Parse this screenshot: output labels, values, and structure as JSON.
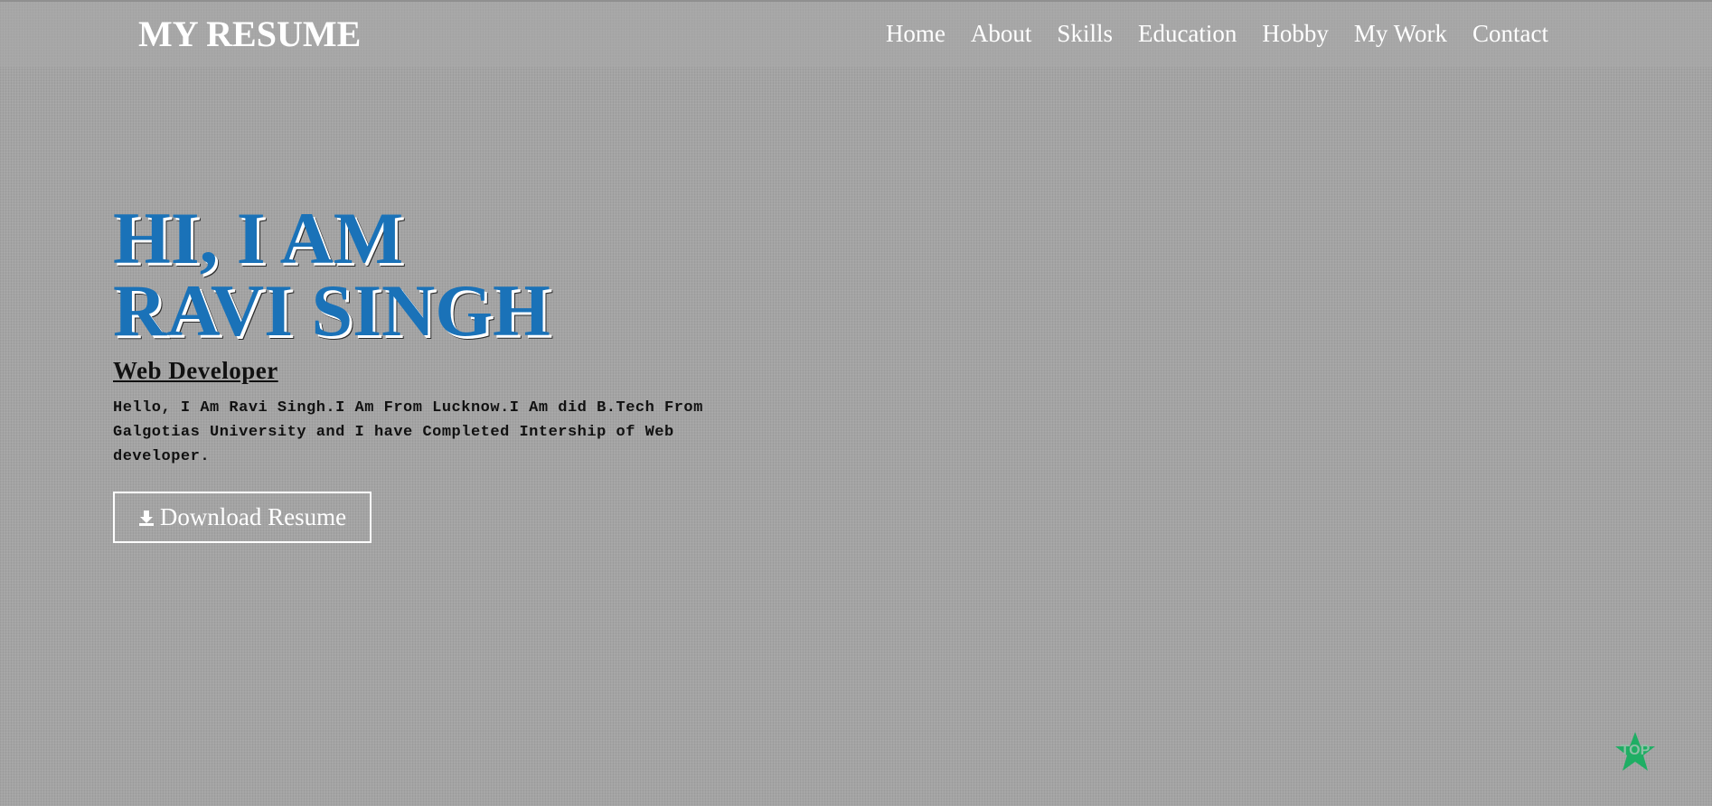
{
  "header": {
    "logo": "MY RESUME",
    "nav": [
      "Home",
      "About",
      "Skills",
      "Education",
      "Hobby",
      "My Work",
      "Contact"
    ]
  },
  "hero": {
    "title_line1": "HI, I AM",
    "title_line2": "RAVI SINGH",
    "role": "Web Developer",
    "intro": "Hello, I Am Ravi Singh.I Am From Lucknow.I Am did B.Tech From Galgotias University and I have Completed Intership of Web developer.",
    "download_label": "Download Resume",
    "download_icon": "download-icon"
  },
  "scroll_top": {
    "label": "TOP",
    "icon": "star-icon",
    "color": "#1fae64"
  },
  "colors": {
    "title": "#1a72b8",
    "background": "#a4a4a4"
  }
}
